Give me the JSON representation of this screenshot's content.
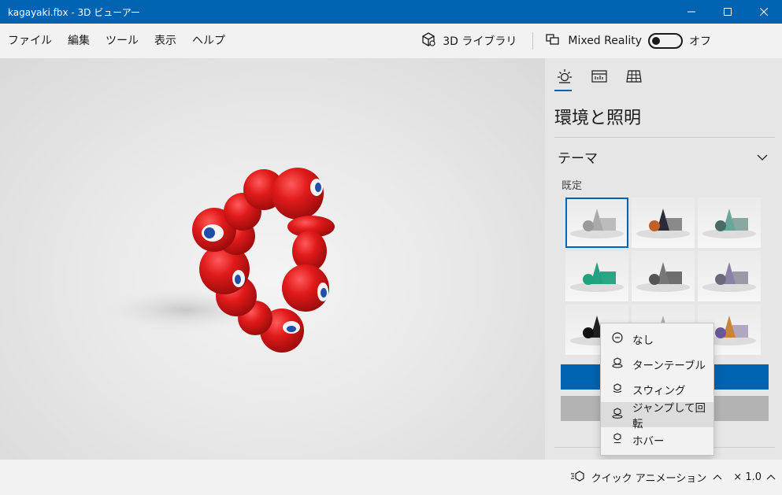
{
  "window": {
    "title": "kagayaki.fbx - 3D ビューアー",
    "minimize_icon": "minimize-icon",
    "maximize_icon": "maximize-icon",
    "close_icon": "close-icon"
  },
  "menu": {
    "items": [
      "ファイル",
      "編集",
      "ツール",
      "表示",
      "ヘルプ"
    ],
    "library_label": "3D ライブラリ",
    "mixed_reality_label": "Mixed Reality",
    "toggle_state_label": "オフ"
  },
  "panel": {
    "tabs": [
      {
        "icon": "sun-icon",
        "active": true
      },
      {
        "icon": "stats-icon",
        "active": false
      },
      {
        "icon": "grid-icon",
        "active": false
      }
    ],
    "title": "環境と照明",
    "theme_section_label": "テーマ",
    "default_label": "既定",
    "themes": [
      {
        "selected": true,
        "ball": "#9a9a9a",
        "cone": "#aaaaaa",
        "box": "#bcbcbc"
      },
      {
        "selected": false,
        "ball": "#c0602a",
        "cone": "#2a2a3a",
        "box": "#8a8a8a"
      },
      {
        "selected": false,
        "ball": "#4d6a66",
        "cone": "#6aa59a",
        "box": "#8aa8a2"
      },
      {
        "selected": false,
        "ball": "#1ea37d",
        "cone": "#25a082",
        "box": "#2aa585"
      },
      {
        "selected": false,
        "ball": "#555555",
        "cone": "#777777",
        "box": "#6e6e6e"
      },
      {
        "selected": false,
        "ball": "#6a6a7a",
        "cone": "#8a82a8",
        "box": "#9a9aa6"
      },
      {
        "selected": false,
        "ball": "#111111",
        "cone": "#222222",
        "box": "#333333"
      },
      {
        "selected": false,
        "ball": "#999999",
        "cone": "#aaaaaa",
        "box": "#bbbbbb"
      },
      {
        "selected": false,
        "ball": "#6a5a9a",
        "cone": "#c8843a",
        "box": "#b0a8c0"
      }
    ]
  },
  "animation_menu": {
    "items": [
      {
        "label": "なし",
        "icon": "none-icon"
      },
      {
        "label": "ターンテーブル",
        "icon": "turntable-icon"
      },
      {
        "label": "スウィング",
        "icon": "swing-icon"
      },
      {
        "label": "ジャンプして回転",
        "icon": "jump-turn-icon",
        "hover": true
      },
      {
        "label": "ホバー",
        "icon": "hover-icon"
      }
    ]
  },
  "status": {
    "quick_animation_label": "クイック アニメーション",
    "speed_label": "× 1.0"
  },
  "colors": {
    "accent": "#0063b1",
    "model_red": "#d81e1e"
  }
}
